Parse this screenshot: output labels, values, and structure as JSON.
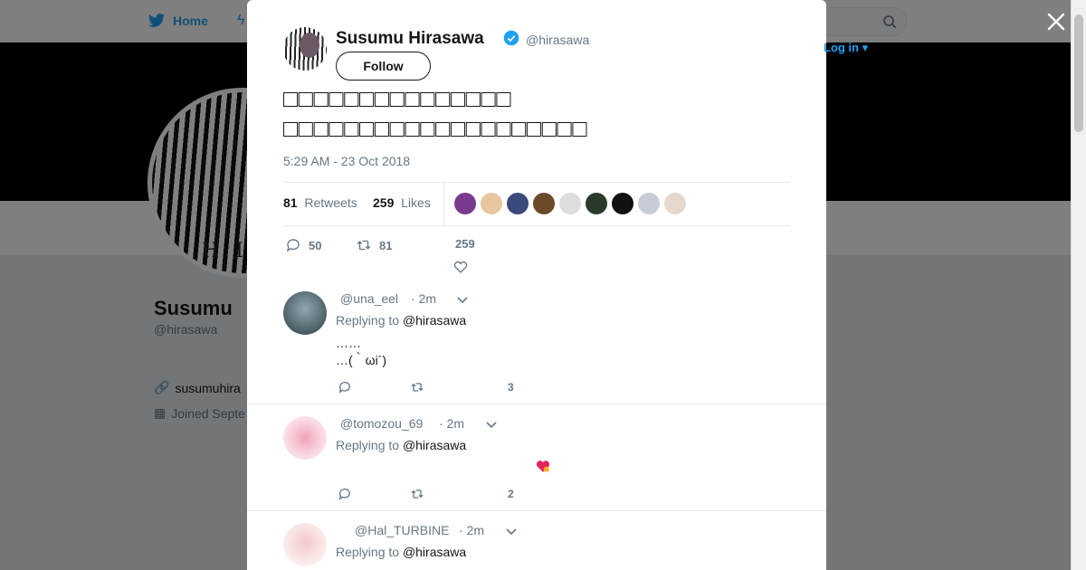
{
  "nav": {
    "home_label": "Home",
    "login_label": "Log in",
    "brand_color": "#1da1f2"
  },
  "profile": {
    "name": "Susumu",
    "handle": "@hirasawa",
    "link": "susumuhira",
    "joined": "Joined Septe",
    "avatar_text": "HIRA"
  },
  "tweet": {
    "author_name": "Susumu Hirasawa",
    "author_handle": "@hirasawa",
    "follow_label": "Follow",
    "text": "□□□□□□□□□□□□□□□\n□□□□□□□□□□□□□□□□□□□□",
    "timestamp": "5:29 AM - 23 Oct 2018",
    "retweets_count": "81",
    "retweets_label": "Retweets",
    "likes_count": "259",
    "likes_label": "Likes",
    "reply_count": "50",
    "retweet_count": "81",
    "like_count": "259",
    "liker_colors": [
      "#7a3b8f",
      "#e8c6a0",
      "#3a4a7a",
      "#6b4a2a",
      "#dddddd",
      "#2a3a2a",
      "#111111",
      "#c8ccd6",
      "#e6d8cc"
    ]
  },
  "replies": [
    {
      "handle": "@una_eel",
      "time": "· 2m",
      "replying_prefix": "Replying to",
      "replying_to": "@hirasawa",
      "text": "……\n…(｀ωi´)",
      "likes": "3"
    },
    {
      "handle": "@tomozou_69",
      "time": "· 2m",
      "replying_prefix": "Replying to",
      "replying_to": "@hirasawa",
      "text": "",
      "likes": "2"
    },
    {
      "handle": "@Hal_TURBINE",
      "time": "· 2m",
      "replying_prefix": "Replying to",
      "replying_to": "@hirasawa",
      "text": "",
      "likes": ""
    }
  ]
}
